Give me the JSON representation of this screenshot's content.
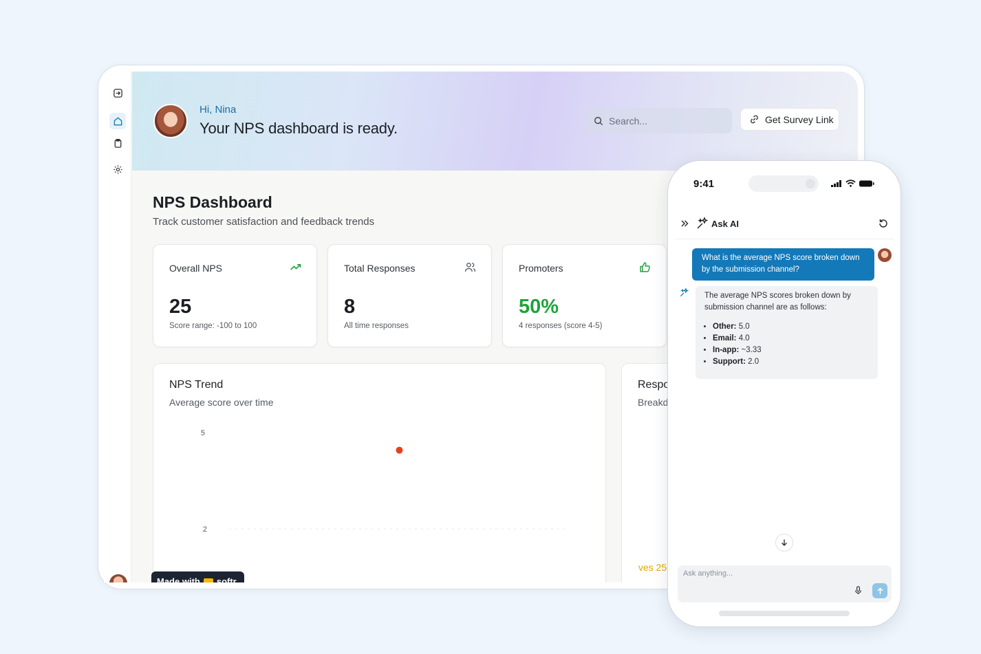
{
  "header": {
    "greeting": "Hi, Nina",
    "title": "Your NPS dashboard is ready.",
    "search_placeholder": "Search...",
    "survey_button": "Get Survey Link"
  },
  "sidebar": {
    "items": [
      {
        "icon": "sign-in-icon"
      },
      {
        "icon": "home-icon",
        "active": true
      },
      {
        "icon": "clipboard-icon"
      },
      {
        "icon": "gear-icon"
      }
    ]
  },
  "dashboard": {
    "title": "NPS Dashboard",
    "subtitle": "Track customer satisfaction and feedback trends"
  },
  "cards": [
    {
      "label": "Overall NPS",
      "value": "25",
      "note": "Score range: -100 to 100",
      "icon": "trending-up-icon",
      "icon_color": "#1fa33a"
    },
    {
      "label": "Total Responses",
      "value": "8",
      "note": "All time responses",
      "icon": "users-icon",
      "icon_color": "#555b63"
    },
    {
      "label": "Promoters",
      "value": "50%",
      "note": "4 responses (score 4-5)",
      "icon": "thumbs-up-icon",
      "icon_color": "#1fa33a",
      "value_color": "#1fa33a"
    }
  ],
  "trend": {
    "title": "NPS Trend",
    "subtitle": "Average score over time"
  },
  "chart_data": {
    "type": "scatter",
    "title": "NPS Trend",
    "y_ticks": [
      "5",
      "2"
    ],
    "points": [
      {
        "y": 4.45
      }
    ],
    "point_color": "#e8401c",
    "grid": true
  },
  "responses_card": {
    "title": "Respo",
    "subtitle": "Breakd",
    "footer": "ves 25"
  },
  "badge": {
    "text_left": "Made with",
    "text_right": "softr"
  },
  "phone": {
    "time": "9:41",
    "panel_title": "Ask AI",
    "user_message": "What is the average NPS score broken down by the submission channel?",
    "bot_intro": "The average NPS scores broken down by submission channel are as follows:",
    "bot_items": [
      {
        "key": "Other:",
        "value": "5.0"
      },
      {
        "key": "Email:",
        "value": "4.0"
      },
      {
        "key": "In-app:",
        "value": "~3.33"
      },
      {
        "key": "Support:",
        "value": "2.0"
      }
    ],
    "input_placeholder": "Ask anything..."
  },
  "colors": {
    "accent": "#1479b8",
    "positive": "#1fa33a",
    "warning": "#e0a800"
  }
}
